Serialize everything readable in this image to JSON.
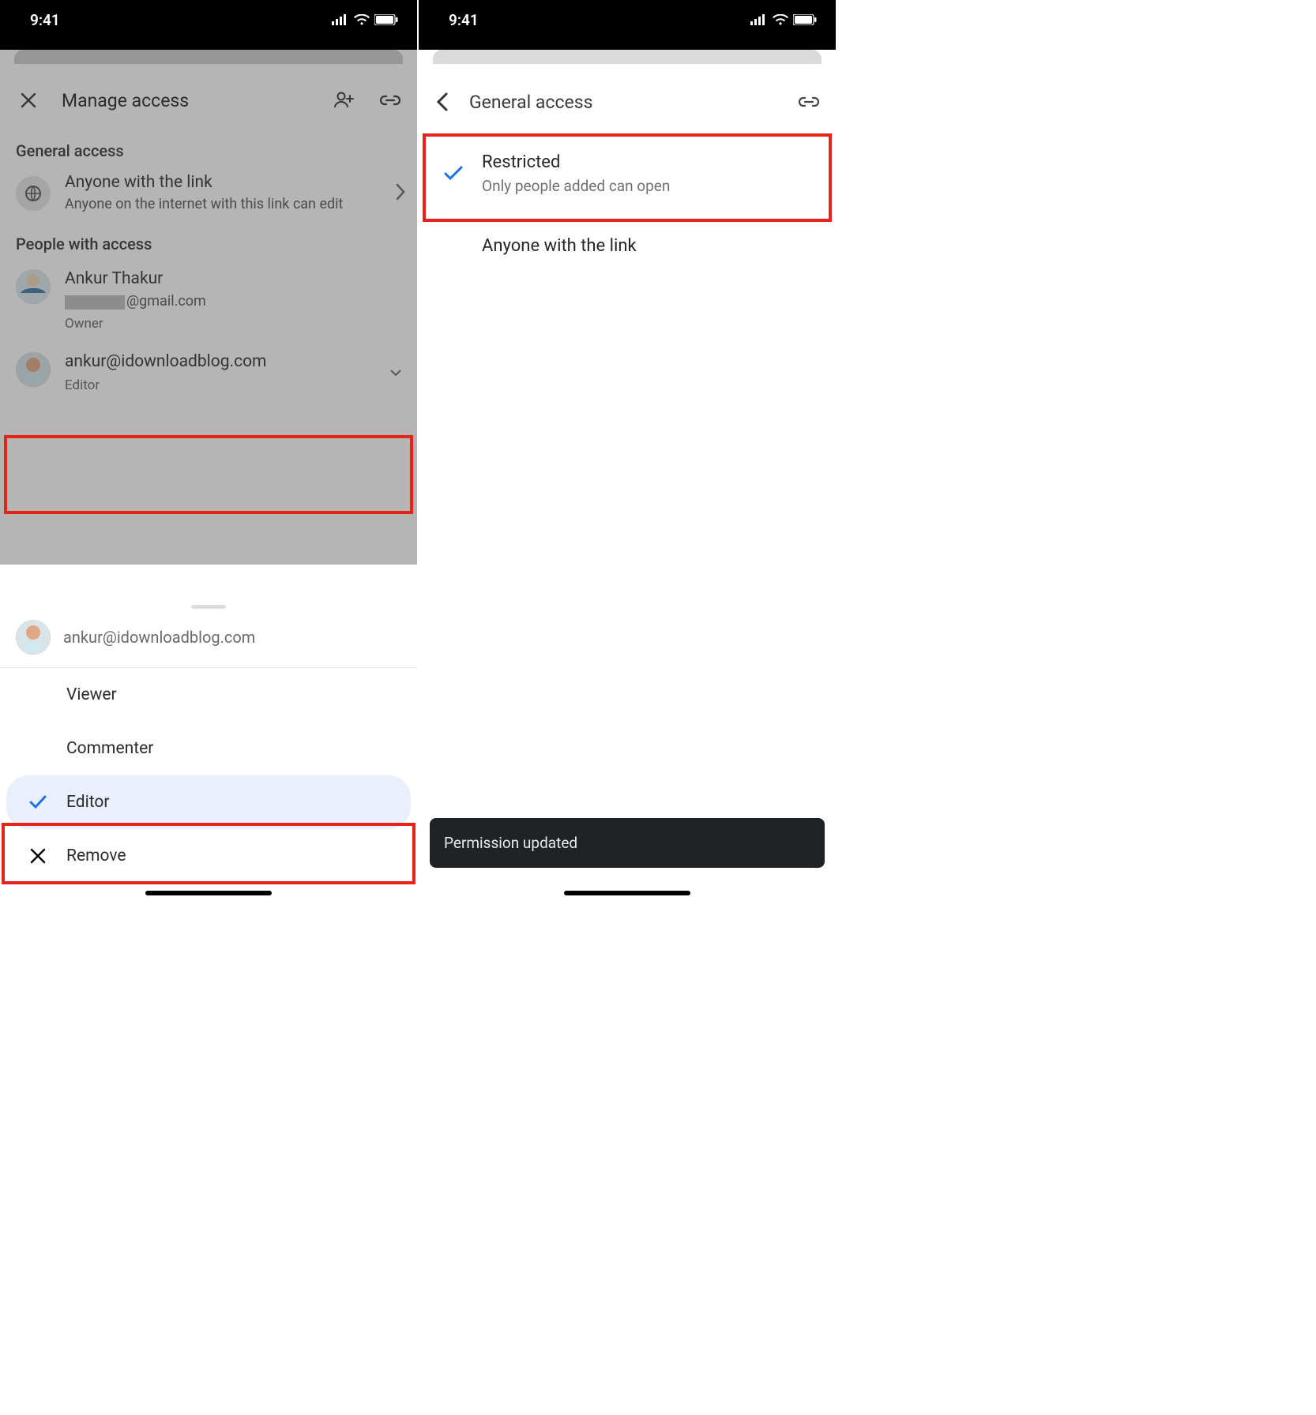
{
  "status": {
    "time": "9:41"
  },
  "left": {
    "manage_title": "Manage access",
    "general_access_label": "General access",
    "ga_title": "Anyone with the link",
    "ga_sub": "Anyone on the internet with this link can edit",
    "people_label": "People with access",
    "owner": {
      "name": "Ankur Thakur",
      "email_suffix": "@gmail.com",
      "role": "Owner"
    },
    "editor": {
      "email": "ankur@idownloadblog.com",
      "role": "Editor"
    },
    "sheet": {
      "email": "ankur@idownloadblog.com",
      "viewer": "Viewer",
      "commenter": "Commenter",
      "editor": "Editor",
      "remove": "Remove"
    }
  },
  "right": {
    "title": "General access",
    "restricted_title": "Restricted",
    "restricted_sub": "Only people added can open",
    "anyone": "Anyone with the link",
    "toast": "Permission updated"
  }
}
